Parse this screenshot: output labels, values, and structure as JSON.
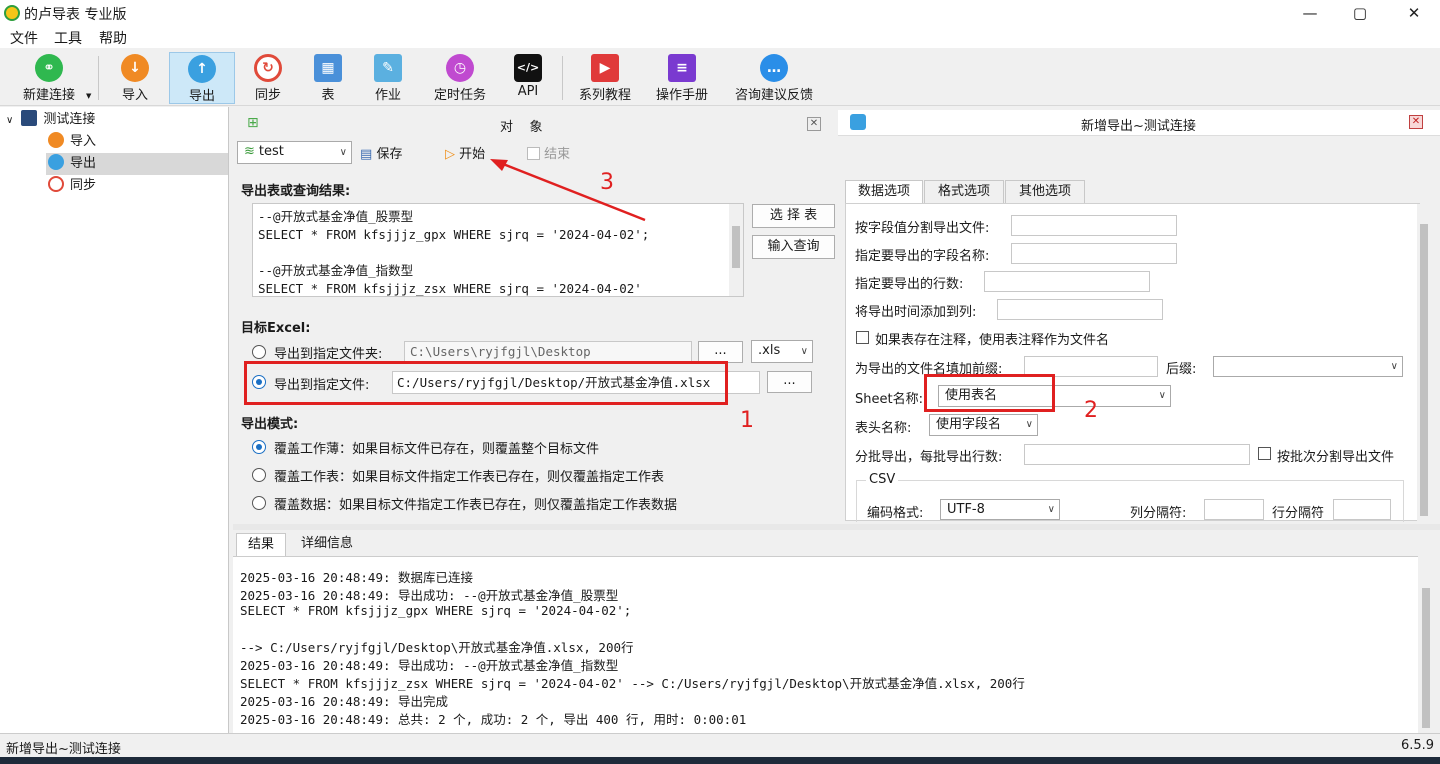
{
  "window": {
    "title": "的卢导表 专业版",
    "minimize": "—",
    "maximize": "▢",
    "close": "✕"
  },
  "menu": [
    "文件",
    "工具",
    "帮助"
  ],
  "toolbar": [
    {
      "label": "新建连接",
      "icon": "link-icon",
      "color": "#2fb84f"
    },
    {
      "label": "导入",
      "icon": "import-icon",
      "color": "#f08a24"
    },
    {
      "label": "导出",
      "icon": "export-icon",
      "color": "#3aa0e0"
    },
    {
      "label": "同步",
      "icon": "sync-icon",
      "color": "#e04a3a"
    },
    {
      "label": "表",
      "icon": "table-icon",
      "color": "#4a90d9"
    },
    {
      "label": "作业",
      "icon": "job-icon",
      "color": "#5bb0e0"
    },
    {
      "label": "定时任务",
      "icon": "timer-icon",
      "color": "#c04ad0"
    },
    {
      "label": "API",
      "icon": "api-icon",
      "color": "#111111"
    },
    {
      "label": "系列教程",
      "icon": "tutorial-icon",
      "color": "#e03a3a"
    },
    {
      "label": "操作手册",
      "icon": "manual-icon",
      "color": "#7a3ad0"
    },
    {
      "label": "咨询建议反馈",
      "icon": "feedback-icon",
      "color": "#2a8ee8"
    }
  ],
  "tree": {
    "root": "测试连接",
    "children": [
      "导入",
      "导出",
      "同步"
    ]
  },
  "objects": {
    "title": "对    象"
  },
  "exportpanel": {
    "db_value": "test",
    "save": "保存",
    "start": "开始",
    "end": "结束",
    "query_label": "导出表或查询结果:",
    "query_lines": [
      "--@开放式基金净值_股票型",
      "SELECT * FROM kfsjjjz_gpx WHERE sjrq = '2024-04-02';",
      "",
      "--@开放式基金净值_指数型",
      "SELECT * FROM kfsjjjz_zsx WHERE sjrq = '2024-04-02'"
    ],
    "select_table": "选 择 表",
    "input_query": "输入查询",
    "target_label": "目标Excel:",
    "to_folder": "导出到指定文件夹:",
    "folder_value": "C:\\Users\\ryjfgjl\\Desktop",
    "browse": "...",
    "ext": ".xls",
    "to_file": "导出到指定文件:",
    "file_value": "C:/Users/ryjfgjl/Desktop/开放式基金净值.xlsx",
    "mode_label": "导出模式:",
    "modes": [
      "覆盖工作薄：如果目标文件已存在，则覆盖整个目标文件",
      "覆盖工作表：如果目标文件指定工作表已存在，则仅覆盖指定工作表",
      "覆盖数据：如果目标文件指定工作表已存在，则仅覆盖指定工作表数据"
    ]
  },
  "annotations": [
    "1",
    "2",
    "3"
  ],
  "rightpanel": {
    "title": "新增导出~测试连接",
    "tabs": [
      "数据选项",
      "格式选项",
      "其他选项"
    ],
    "fields": {
      "split_by_value": "按字段值分割导出文件:",
      "field_name": "指定要导出的字段名称:",
      "rows": "指定要导出的行数:",
      "time_col": "将导出时间添加到列:",
      "comment_as_name": "如果表存在注释，使用表注释作为文件名",
      "prefix": "为导出的文件名填加前缀:",
      "suffix": "后缀:",
      "sheet_label": "Sheet名称:",
      "sheet_value": "使用表名",
      "header_label": "表头名称:",
      "header_value": "使用字段名",
      "batch_label": "分批导出，每批导出行数:",
      "batch_split": "按批次分割导出文件",
      "csv": "CSV",
      "encoding_label": "编码格式:",
      "encoding_value": "UTF-8",
      "col_sep": "列分隔符:",
      "row_sep": "行分隔符"
    }
  },
  "results": {
    "tabs": [
      "结果",
      "详细信息"
    ],
    "lines": [
      "2025-03-16 20:48:49: 数据库已连接",
      "2025-03-16 20:48:49: 导出成功: --@开放式基金净值_股票型",
      "SELECT * FROM kfsjjjz_gpx WHERE sjrq = '2024-04-02';",
      "",
      " --> C:/Users/ryjfgjl/Desktop\\开放式基金净值.xlsx, 200行",
      "2025-03-16 20:48:49: 导出成功: --@开放式基金净值_指数型",
      "SELECT * FROM kfsjjjz_zsx WHERE sjrq = '2024-04-02' --> C:/Users/ryjfgjl/Desktop\\开放式基金净值.xlsx, 200行",
      "2025-03-16 20:48:49: 导出完成",
      "2025-03-16 20:48:49: 总共: 2 个, 成功: 2 个, 导出 400 行, 用时: 0:00:01"
    ]
  },
  "status": {
    "left": "新增导出~测试连接",
    "version": "6.5.9"
  }
}
